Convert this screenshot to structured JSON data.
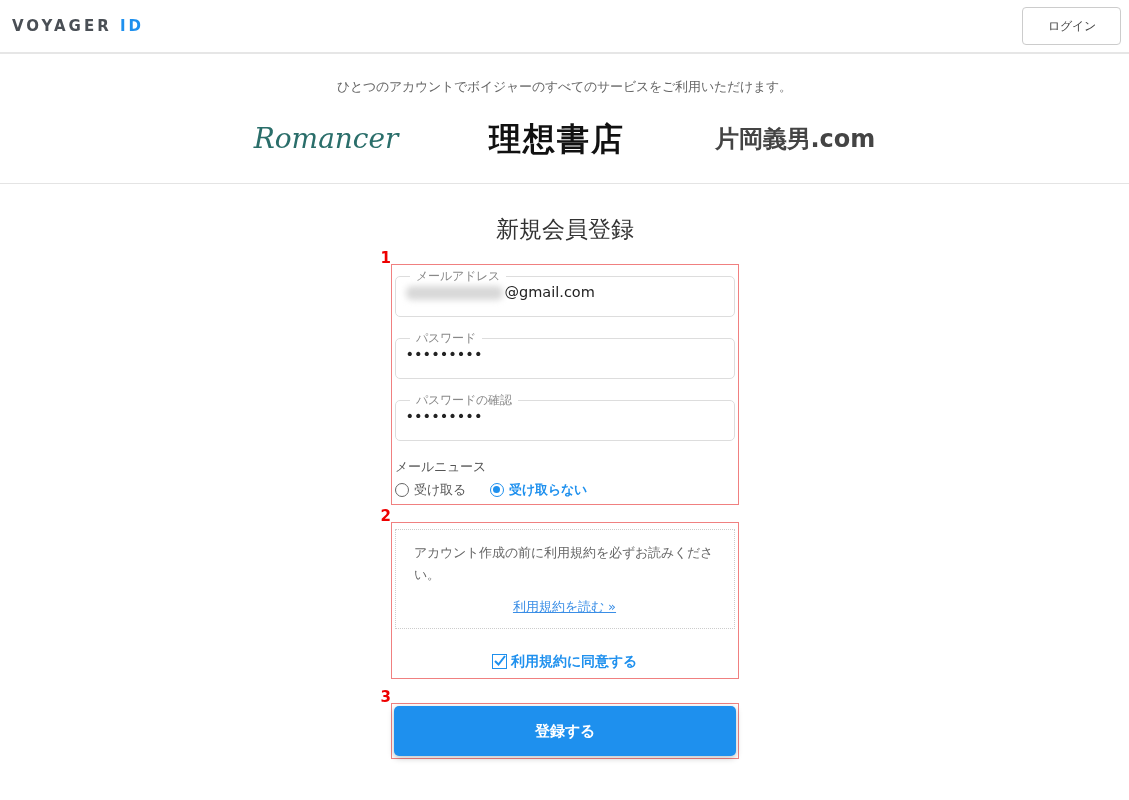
{
  "header": {
    "logo": {
      "main": "VOYAGER",
      "accent": "ID"
    },
    "login_button": "ログイン"
  },
  "services": {
    "tagline": "ひとつのアカウントでボイジャーのすべてのサービスをご利用いただけます。",
    "logos": [
      {
        "kind": "script",
        "text": "Romancer",
        "color": "#2a6e6a"
      },
      {
        "kind": "blocky",
        "text": "理想書店",
        "color": "#111111"
      },
      {
        "kind": "bold",
        "text": "片岡義男.com",
        "color": "#444444"
      }
    ]
  },
  "form": {
    "title": "新規会員登録",
    "fields": [
      {
        "label": "メールアドレス",
        "value": "@gmail.com",
        "blurred_prefix": true
      },
      {
        "label": "パスワード",
        "value": "•••••••••",
        "blurred_prefix": false
      },
      {
        "label": "パスワードの確認",
        "value": "•••••••••",
        "blurred_prefix": false
      }
    ],
    "newsletter": {
      "label": "メールニュース",
      "options": [
        {
          "label": "受け取る",
          "selected": false
        },
        {
          "label": "受け取らない",
          "selected": true
        }
      ]
    },
    "terms": {
      "text": "アカウント作成の前に利用規約を必ずお読みください。",
      "link": "利用規約を読む »",
      "agree_label": "利用規約に同意する",
      "checked": true
    },
    "submit": "登録する"
  },
  "annotations": [
    {
      "label": "1"
    },
    {
      "label": "2"
    },
    {
      "label": "3"
    }
  ]
}
